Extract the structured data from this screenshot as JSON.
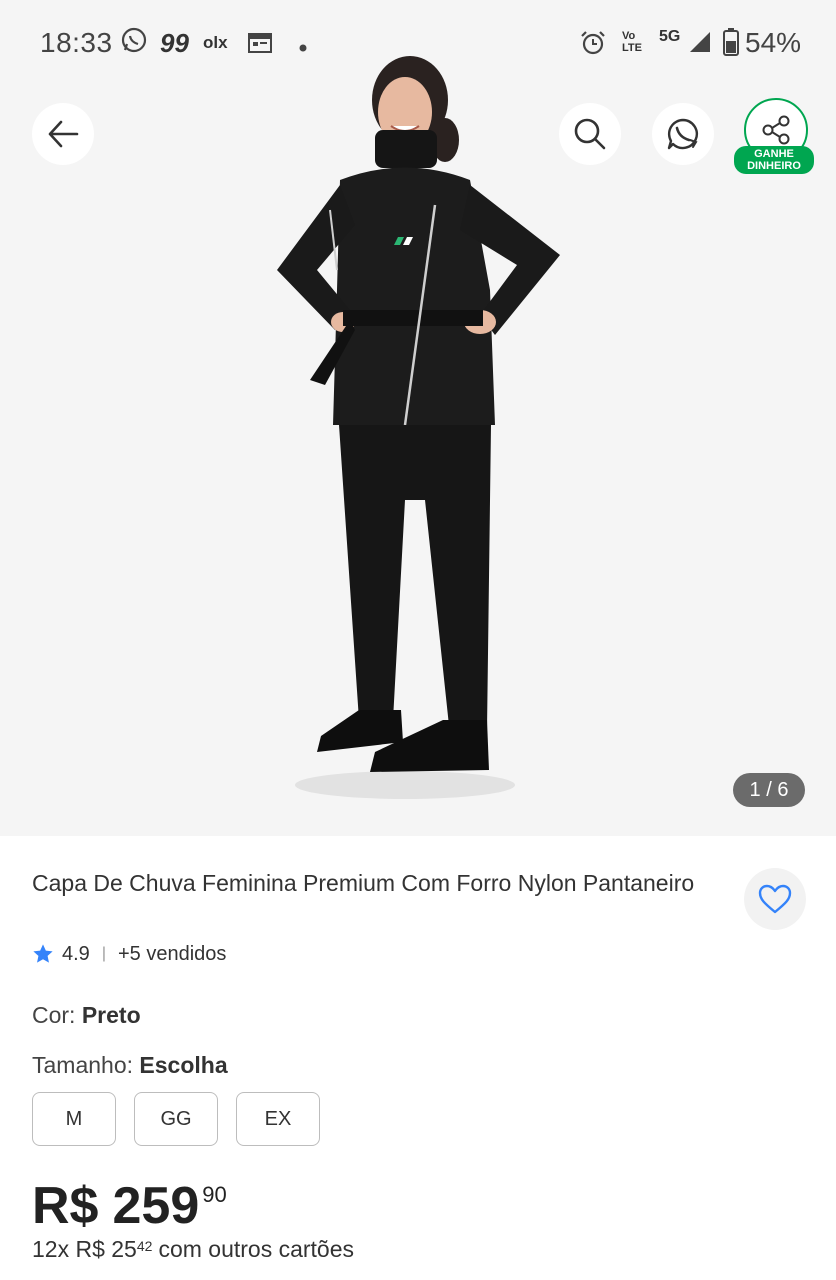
{
  "status_bar": {
    "time": "18:33",
    "app_badge_99": "99",
    "app_badge_olx": "olx",
    "network_lte": "LTE",
    "network_vo": "Vo",
    "network_5g": "5G",
    "battery": "54%"
  },
  "gallery": {
    "counter": "1 / 6",
    "share_badge": "GANHE DINHEIRO"
  },
  "product": {
    "title": "Capa De Chuva Feminina Premium Com Forro Nylon Pantaneiro",
    "rating": "4.9",
    "separator": "|",
    "sold": "+5 vendidos"
  },
  "options": {
    "color_label": "Cor:",
    "color_value": "Preto",
    "size_label": "Tamanho:",
    "size_value": "Escolha",
    "sizes": [
      "M",
      "GG",
      "EX"
    ]
  },
  "price": {
    "currency": "R$",
    "integer": "259",
    "cents": "90",
    "installments_prefix": "12x R$ 25",
    "installments_cents": "42",
    "installments_suffix": "com outros cartões"
  },
  "colors": {
    "accent_blue": "#3483fa",
    "green": "#00a650",
    "counter_bg": "#6b6b6b"
  }
}
